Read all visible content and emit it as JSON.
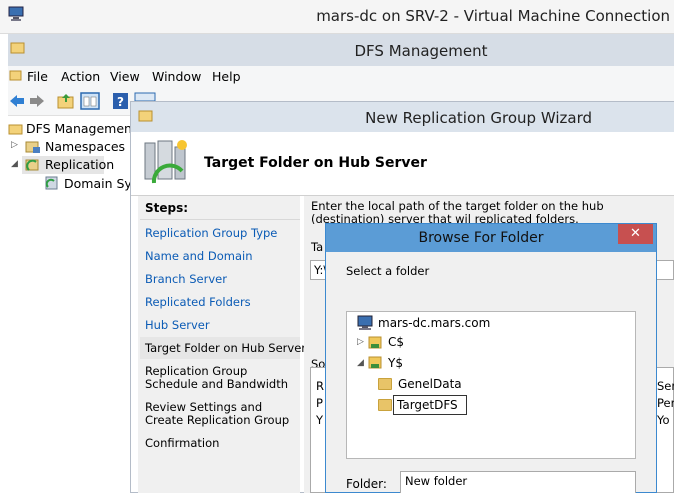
{
  "vm_window": {
    "title": "mars-dc on SRV-2 - Virtual Machine Connection"
  },
  "dfs_window": {
    "title": "DFS Management",
    "menu": [
      "File",
      "Action",
      "View",
      "Window",
      "Help"
    ],
    "tree": {
      "root": "DFS Management",
      "items": [
        "Namespaces",
        "Replication",
        "Domain Syst"
      ]
    }
  },
  "wizard": {
    "title": "New Replication Group Wizard",
    "heading": "Target Folder on Hub Server",
    "steps_label": "Steps:",
    "steps": [
      "Replication Group Type",
      "Name and Domain",
      "Branch Server",
      "Replicated Folders",
      "Hub Server",
      "Target Folder on Hub Server",
      "Replication Group Schedule and Bandwidth",
      "Review Settings and Create Replication Group",
      "Confirmation"
    ],
    "current_step": "Target Folder on Hub Server",
    "instruction": "Enter the local path of the target folder on the hub (destination) server that wil replicated folders.",
    "path_label": "Ta",
    "path_value": "Y:\\",
    "group_label": "So",
    "group_col1": [
      "R",
      "P",
      "Y"
    ],
    "group_col2": [
      "Ser",
      "Per",
      "Yo"
    ]
  },
  "browse_dialog": {
    "title": "Browse For Folder",
    "close_glyph": "✕",
    "select_label": "Select a folder",
    "tree": {
      "root": "mars-dc.mars.com",
      "drives": [
        "C$",
        "Y$"
      ],
      "children": [
        "GenelData",
        "TargetDFS"
      ]
    },
    "folder_label": "Folder:",
    "folder_value": "New folder"
  },
  "colors": {
    "link_blue": "#0b5bb5",
    "dialog_title": "#5b9cd6",
    "close_red": "#c75050"
  }
}
